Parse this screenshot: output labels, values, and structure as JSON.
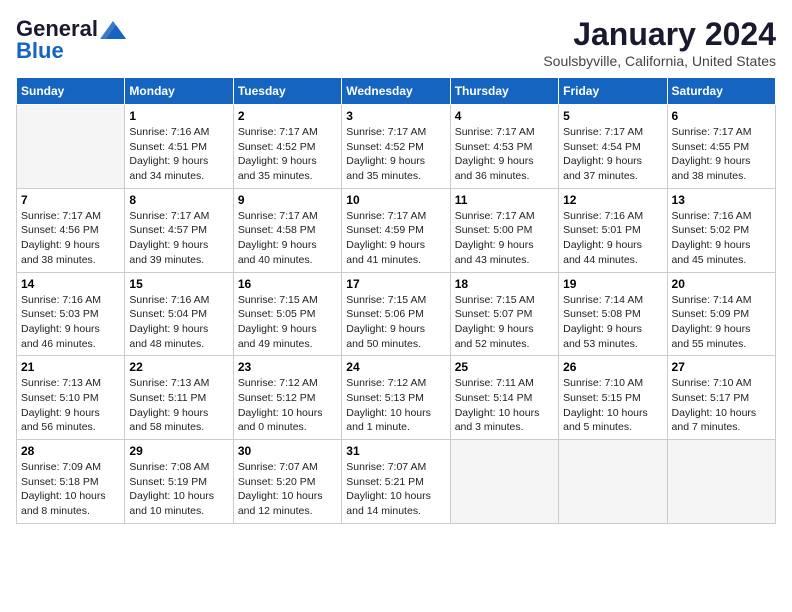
{
  "header": {
    "logo_general": "General",
    "logo_blue": "Blue",
    "month_year": "January 2024",
    "location": "Soulsbyville, California, United States"
  },
  "weekdays": [
    "Sunday",
    "Monday",
    "Tuesday",
    "Wednesday",
    "Thursday",
    "Friday",
    "Saturday"
  ],
  "weeks": [
    [
      {
        "day": "",
        "text": ""
      },
      {
        "day": "1",
        "text": "Sunrise: 7:16 AM\nSunset: 4:51 PM\nDaylight: 9 hours\nand 34 minutes."
      },
      {
        "day": "2",
        "text": "Sunrise: 7:17 AM\nSunset: 4:52 PM\nDaylight: 9 hours\nand 35 minutes."
      },
      {
        "day": "3",
        "text": "Sunrise: 7:17 AM\nSunset: 4:52 PM\nDaylight: 9 hours\nand 35 minutes."
      },
      {
        "day": "4",
        "text": "Sunrise: 7:17 AM\nSunset: 4:53 PM\nDaylight: 9 hours\nand 36 minutes."
      },
      {
        "day": "5",
        "text": "Sunrise: 7:17 AM\nSunset: 4:54 PM\nDaylight: 9 hours\nand 37 minutes."
      },
      {
        "day": "6",
        "text": "Sunrise: 7:17 AM\nSunset: 4:55 PM\nDaylight: 9 hours\nand 38 minutes."
      }
    ],
    [
      {
        "day": "7",
        "text": "Sunrise: 7:17 AM\nSunset: 4:56 PM\nDaylight: 9 hours\nand 38 minutes."
      },
      {
        "day": "8",
        "text": "Sunrise: 7:17 AM\nSunset: 4:57 PM\nDaylight: 9 hours\nand 39 minutes."
      },
      {
        "day": "9",
        "text": "Sunrise: 7:17 AM\nSunset: 4:58 PM\nDaylight: 9 hours\nand 40 minutes."
      },
      {
        "day": "10",
        "text": "Sunrise: 7:17 AM\nSunset: 4:59 PM\nDaylight: 9 hours\nand 41 minutes."
      },
      {
        "day": "11",
        "text": "Sunrise: 7:17 AM\nSunset: 5:00 PM\nDaylight: 9 hours\nand 43 minutes."
      },
      {
        "day": "12",
        "text": "Sunrise: 7:16 AM\nSunset: 5:01 PM\nDaylight: 9 hours\nand 44 minutes."
      },
      {
        "day": "13",
        "text": "Sunrise: 7:16 AM\nSunset: 5:02 PM\nDaylight: 9 hours\nand 45 minutes."
      }
    ],
    [
      {
        "day": "14",
        "text": "Sunrise: 7:16 AM\nSunset: 5:03 PM\nDaylight: 9 hours\nand 46 minutes."
      },
      {
        "day": "15",
        "text": "Sunrise: 7:16 AM\nSunset: 5:04 PM\nDaylight: 9 hours\nand 48 minutes."
      },
      {
        "day": "16",
        "text": "Sunrise: 7:15 AM\nSunset: 5:05 PM\nDaylight: 9 hours\nand 49 minutes."
      },
      {
        "day": "17",
        "text": "Sunrise: 7:15 AM\nSunset: 5:06 PM\nDaylight: 9 hours\nand 50 minutes."
      },
      {
        "day": "18",
        "text": "Sunrise: 7:15 AM\nSunset: 5:07 PM\nDaylight: 9 hours\nand 52 minutes."
      },
      {
        "day": "19",
        "text": "Sunrise: 7:14 AM\nSunset: 5:08 PM\nDaylight: 9 hours\nand 53 minutes."
      },
      {
        "day": "20",
        "text": "Sunrise: 7:14 AM\nSunset: 5:09 PM\nDaylight: 9 hours\nand 55 minutes."
      }
    ],
    [
      {
        "day": "21",
        "text": "Sunrise: 7:13 AM\nSunset: 5:10 PM\nDaylight: 9 hours\nand 56 minutes."
      },
      {
        "day": "22",
        "text": "Sunrise: 7:13 AM\nSunset: 5:11 PM\nDaylight: 9 hours\nand 58 minutes."
      },
      {
        "day": "23",
        "text": "Sunrise: 7:12 AM\nSunset: 5:12 PM\nDaylight: 10 hours\nand 0 minutes."
      },
      {
        "day": "24",
        "text": "Sunrise: 7:12 AM\nSunset: 5:13 PM\nDaylight: 10 hours\nand 1 minute."
      },
      {
        "day": "25",
        "text": "Sunrise: 7:11 AM\nSunset: 5:14 PM\nDaylight: 10 hours\nand 3 minutes."
      },
      {
        "day": "26",
        "text": "Sunrise: 7:10 AM\nSunset: 5:15 PM\nDaylight: 10 hours\nand 5 minutes."
      },
      {
        "day": "27",
        "text": "Sunrise: 7:10 AM\nSunset: 5:17 PM\nDaylight: 10 hours\nand 7 minutes."
      }
    ],
    [
      {
        "day": "28",
        "text": "Sunrise: 7:09 AM\nSunset: 5:18 PM\nDaylight: 10 hours\nand 8 minutes."
      },
      {
        "day": "29",
        "text": "Sunrise: 7:08 AM\nSunset: 5:19 PM\nDaylight: 10 hours\nand 10 minutes."
      },
      {
        "day": "30",
        "text": "Sunrise: 7:07 AM\nSunset: 5:20 PM\nDaylight: 10 hours\nand 12 minutes."
      },
      {
        "day": "31",
        "text": "Sunrise: 7:07 AM\nSunset: 5:21 PM\nDaylight: 10 hours\nand 14 minutes."
      },
      {
        "day": "",
        "text": ""
      },
      {
        "day": "",
        "text": ""
      },
      {
        "day": "",
        "text": ""
      }
    ]
  ]
}
